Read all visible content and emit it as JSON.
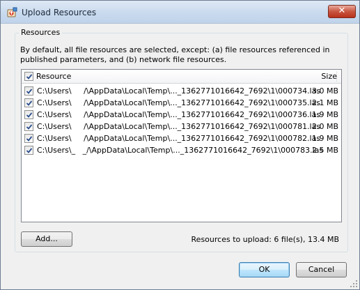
{
  "window": {
    "title": "Upload Resources",
    "close_glyph": "✕"
  },
  "group": {
    "label": "Resources",
    "description": "By default, all file resources are selected, except: (a) file resources referenced in published parameters, and (b) network file resources."
  },
  "table": {
    "columns": {
      "resource": "Resource",
      "size": "Size"
    },
    "rows": [
      {
        "checked": true,
        "resource": "C:\\Users\\     /\\AppData\\Local\\Temp\\..._1362771016642_7692\\1\\000734.las",
        "size": "3.0 MB"
      },
      {
        "checked": true,
        "resource": "C:\\Users\\     /\\AppData\\Local\\Temp\\..._1362771016642_7692\\1\\000735.las",
        "size": "2.1 MB"
      },
      {
        "checked": true,
        "resource": "C:\\Users\\     /\\AppData\\Local\\Temp\\..._1362771016642_7692\\1\\000736.las",
        "size": "1.9 MB"
      },
      {
        "checked": true,
        "resource": "C:\\Users\\     /\\AppData\\Local\\Temp\\..._1362771016642_7692\\1\\000781.las",
        "size": "2.0 MB"
      },
      {
        "checked": true,
        "resource": "C:\\Users\\     /\\AppData\\Local\\Temp\\..._1362771016642_7692\\1\\000782.las",
        "size": "1.9 MB"
      },
      {
        "checked": true,
        "resource": "C:\\Users\\_   _/\\AppData\\Local\\Temp\\..._1362771016642_7692\\1\\000783.las",
        "size": "2.5 MB"
      }
    ]
  },
  "footer": {
    "add_label": "Add...",
    "summary": "Resources to upload: 6 file(s), 13.4 MB"
  },
  "buttons": {
    "ok": "OK",
    "cancel": "Cancel"
  },
  "icons": {
    "title": "upload-resources-icon",
    "check": "checkmark-icon",
    "grip": "resize-grip-icon"
  },
  "colors": {
    "accent": "#3c7fb1",
    "close": "#c8553f"
  }
}
